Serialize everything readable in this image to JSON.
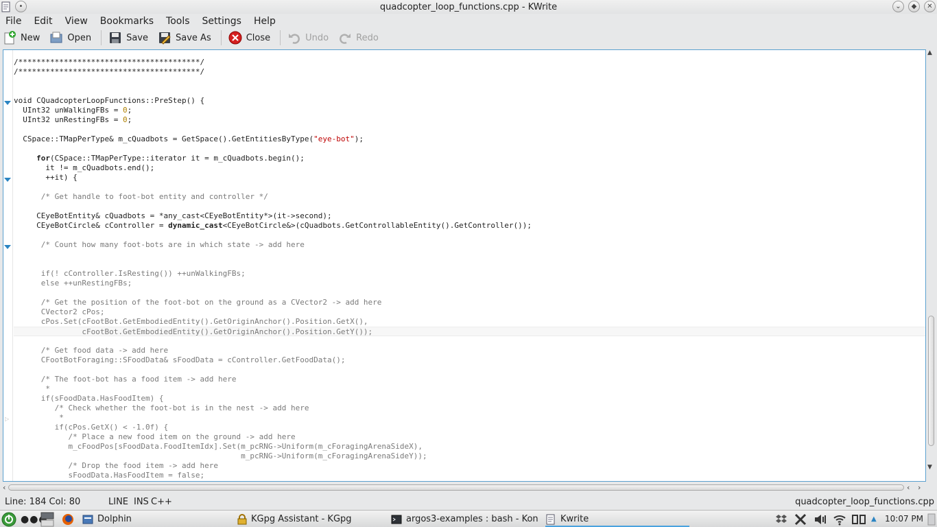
{
  "window": {
    "title": "quadcopter_loop_functions.cpp - KWrite"
  },
  "menu": [
    "File",
    "Edit",
    "View",
    "Bookmarks",
    "Tools",
    "Settings",
    "Help"
  ],
  "toolbar": {
    "new": "New",
    "open": "Open",
    "save": "Save",
    "save_as": "Save As",
    "close": "Close",
    "undo": "Undo",
    "redo": "Redo"
  },
  "code": [
    "/****************************************/",
    "/****************************************/",
    "",
    "",
    "void CQuadcopterLoopFunctions::PreStep() {",
    "  UInt32 unWalkingFBs = 0;",
    "  UInt32 unRestingFBs = 0;",
    "",
    "  CSpace::TMapPerType& m_cQuadbots = GetSpace().GetEntitiesByType(\"eye-bot\");",
    "",
    "     for(CSpace::TMapPerType::iterator it = m_cQuadbots.begin();",
    "       it != m_cQuadbots.end();",
    "       ++it) {",
    "",
    "      /* Get handle to foot-bot entity and controller */",
    "",
    "     CEyeBotEntity& cQuadbots = *any_cast<CEyeBotEntity*>(it->second);",
    "     CEyeBotCircle& cController = dynamic_cast<CEyeBotCircle&>(cQuadbots.GetControllableEntity().GetController());",
    "",
    "      /* Count how many foot-bots are in which state -> add here",
    "",
    "",
    "      if(! cController.IsResting()) ++unWalkingFBs;",
    "      else ++unRestingFBs;",
    "",
    "      /* Get the position of the foot-bot on the ground as a CVector2 -> add here",
    "      CVector2 cPos;",
    "      cPos.Set(cFootBot.GetEmbodiedEntity().GetOriginAnchor().Position.GetX(),",
    "               cFootBot.GetEmbodiedEntity().GetOriginAnchor().Position.GetY());",
    "",
    "      /* Get food data -> add here",
    "      CFootBotForaging::SFoodData& sFoodData = cController.GetFoodData();",
    "",
    "      /* The foot-bot has a food item -> add here",
    "       *",
    "      if(sFoodData.HasFoodItem) {",
    "         /* Check whether the foot-bot is in the nest -> add here",
    "          *",
    "         if(cPos.GetX() < -1.0f) {",
    "            /* Place a new food item on the ground -> add here",
    "            m_cFoodPos[sFoodData.FoodItemIdx].Set(m_pcRNG->Uniform(m_cForagingArenaSideX),",
    "                                                  m_pcRNG->Uniform(m_cForagingArenaSideY));",
    "            /* Drop the food item -> add here",
    "            sFoodData.HasFoodItem = false;"
  ],
  "status": {
    "position": "Line: 184 Col: 80",
    "mode": "LINE",
    "insert": "INS",
    "language": "C++",
    "filename": "quadcopter_loop_functions.cpp"
  },
  "taskbar": {
    "dolphin": "Dolphin",
    "kgpg": "KGpg Assistant - KGpg",
    "konsole": "argos3-examples : bash - Kon",
    "kwrite": "Kwrite",
    "clock": "10:07 PM"
  },
  "colors": {
    "accent": "#4aa3df",
    "editor_border": "#5aa0cf",
    "string": "#bf0303",
    "number": "#b08000"
  }
}
